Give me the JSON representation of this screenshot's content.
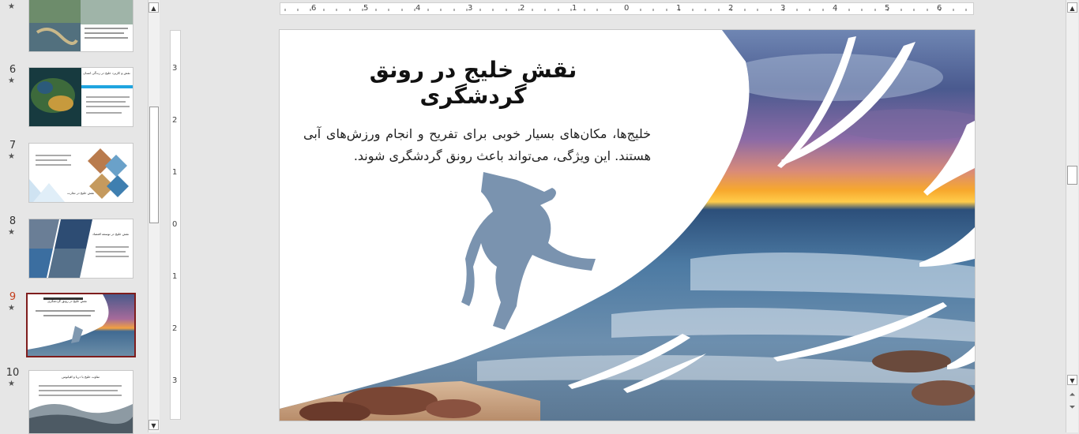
{
  "thumbnails": [
    {
      "number": "",
      "title": ""
    },
    {
      "number": "6",
      "title": "نقش و کاربرد خلیج در زندگی انسان"
    },
    {
      "number": "7",
      "title": "نقش خلیج در تجارت"
    },
    {
      "number": "8",
      "title": "نقش خلیج در توسعه اقتصاد"
    },
    {
      "number": "9",
      "title": "نقش خلیج در رونق گردشگری"
    },
    {
      "number": "10",
      "title": "تفاوت خلیج با دریا و اقیانوس"
    }
  ],
  "star_glyph": "★",
  "slide": {
    "title": "نقش خلیج در رونق گردشگری",
    "body": "خلیج‌ها، مکان‌های بسیار خوبی برای تفریح و انجام ورزش‌های آبی هستند. این ویژگی، می‌تواند باعث رونق گردشگری شوند."
  },
  "ruler": {
    "horizontal_labels": [
      "6",
      "5",
      "4",
      "3",
      "2",
      "1",
      "0",
      "1",
      "2",
      "3",
      "4",
      "5",
      "6"
    ],
    "vertical_labels": [
      "3",
      "2",
      "1",
      "0",
      "1",
      "2",
      "3"
    ]
  },
  "colors": {
    "selection_border": "#7f1d1d",
    "selected_number": "#c43e1c",
    "accent_blue": "#1fa5e0"
  }
}
